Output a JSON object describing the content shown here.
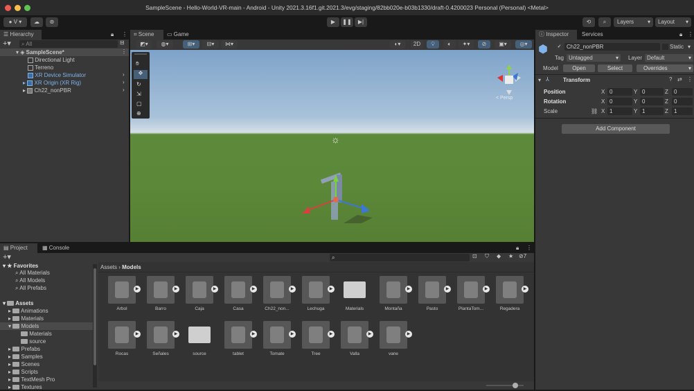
{
  "window": {
    "title": "SampleScene - Hello-World-VR-main - Android - Unity 2021.3.16f1.git.2021.3/evg/staging/82bb020e-b03b1330/draft-0.4200023 Personal (Personal) <Metal>"
  },
  "toolbar": {
    "account": "V",
    "layers": "Layers",
    "layout": "Layout"
  },
  "hierarchy": {
    "tab": "Hierarchy",
    "search_placeholder": "All",
    "scene": "SampleScene*",
    "items": [
      "Directional Light",
      "Terreno",
      "XR Device Simulator",
      "XR Origin (XR Rig)",
      "Ch22_nonPBR"
    ]
  },
  "scene_view": {
    "tabs": [
      "Scene",
      "Game"
    ],
    "mode_2d": "2D",
    "gizmo_label": "< Persp"
  },
  "inspector": {
    "tabs": [
      "Inspector",
      "Services"
    ],
    "object_name": "Ch22_nonPBR",
    "static_label": "Static",
    "tag_label": "Tag",
    "tag_value": "Untagged",
    "layer_label": "Layer",
    "layer_value": "Default",
    "model_label": "Model",
    "open": "Open",
    "select": "Select",
    "overrides": "Overrides",
    "transform": "Transform",
    "rows": [
      {
        "label": "Position",
        "x": "0",
        "y": "0",
        "z": "0"
      },
      {
        "label": "Rotation",
        "x": "0",
        "y": "0",
        "z": "0"
      },
      {
        "label": "Scale",
        "x": "1",
        "y": "1",
        "z": "1"
      }
    ],
    "axis": [
      "X",
      "Y",
      "Z"
    ],
    "add_component": "Add Component"
  },
  "project": {
    "tabs": [
      "Project",
      "Console"
    ],
    "breadcrumb": [
      "Assets",
      "Models"
    ],
    "badge_count": "7",
    "favorites": {
      "label": "Favorites",
      "items": [
        "All Materials",
        "All Models",
        "All Prefabs"
      ]
    },
    "assets": {
      "label": "Assets",
      "items": [
        "Animations",
        "Materials",
        "Models",
        "Materials",
        "source",
        "Prefabs",
        "Samples",
        "Scenes",
        "Scripts",
        "TextMesh Pro",
        "Textures"
      ]
    },
    "grid_row1": [
      "Arbol",
      "Barro",
      "Caja",
      "Casa",
      "Ch22_non...",
      "Lechuga",
      "Materials",
      "Montaña",
      "Pasto",
      "PlantaTom...",
      "Regadera"
    ],
    "grid_row2": [
      "Rocas",
      "Señales",
      "source",
      "tablet",
      "Tomate",
      "Tree",
      "Valla",
      "vane"
    ]
  },
  "colors": {
    "accent": "#2c5d87",
    "sky_top": "#7ea3c9",
    "ground": "#5d8a3a",
    "prefab_blue": "#7fb3ea"
  }
}
